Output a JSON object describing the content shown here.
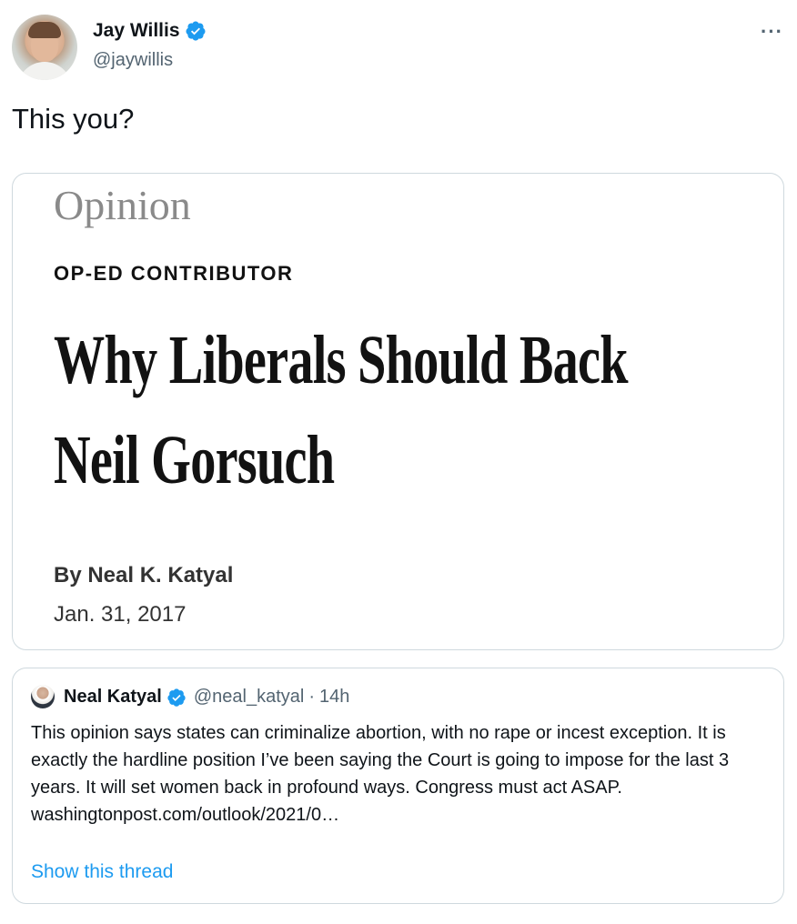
{
  "author": {
    "name": "Jay Willis",
    "handle": "@jaywillis",
    "verified_icon": "verified-badge-icon",
    "more_icon": "more-options-icon",
    "more_label": "···"
  },
  "tweet": {
    "text": "This you?"
  },
  "article_card": {
    "section": "Opinion",
    "kicker": "OP-ED CONTRIBUTOR",
    "headline_line1": "Why Liberals Should Back",
    "headline_line2": "Neil Gorsuch",
    "byline": "By Neal K. Katyal",
    "date": "Jan. 31, 2017"
  },
  "quoted_tweet": {
    "name": "Neal Katyal",
    "handle": "@neal_katyal",
    "separator": "·",
    "time": "14h",
    "body": "This opinion says states can criminalize abortion, with no rape or incest exception. It is exactly the hardline position I’ve been saying the Court is going to impose for the last 3 years. It will set women back in profound ways. Congress must act ASAP.",
    "link": "washingtonpost.com/outlook/2021/0…",
    "show_thread": "Show this thread"
  },
  "colors": {
    "verified_blue": "#1d9bf0",
    "link_blue": "#1d9bf0",
    "secondary_text": "#536471",
    "border": "#cfd9de"
  }
}
